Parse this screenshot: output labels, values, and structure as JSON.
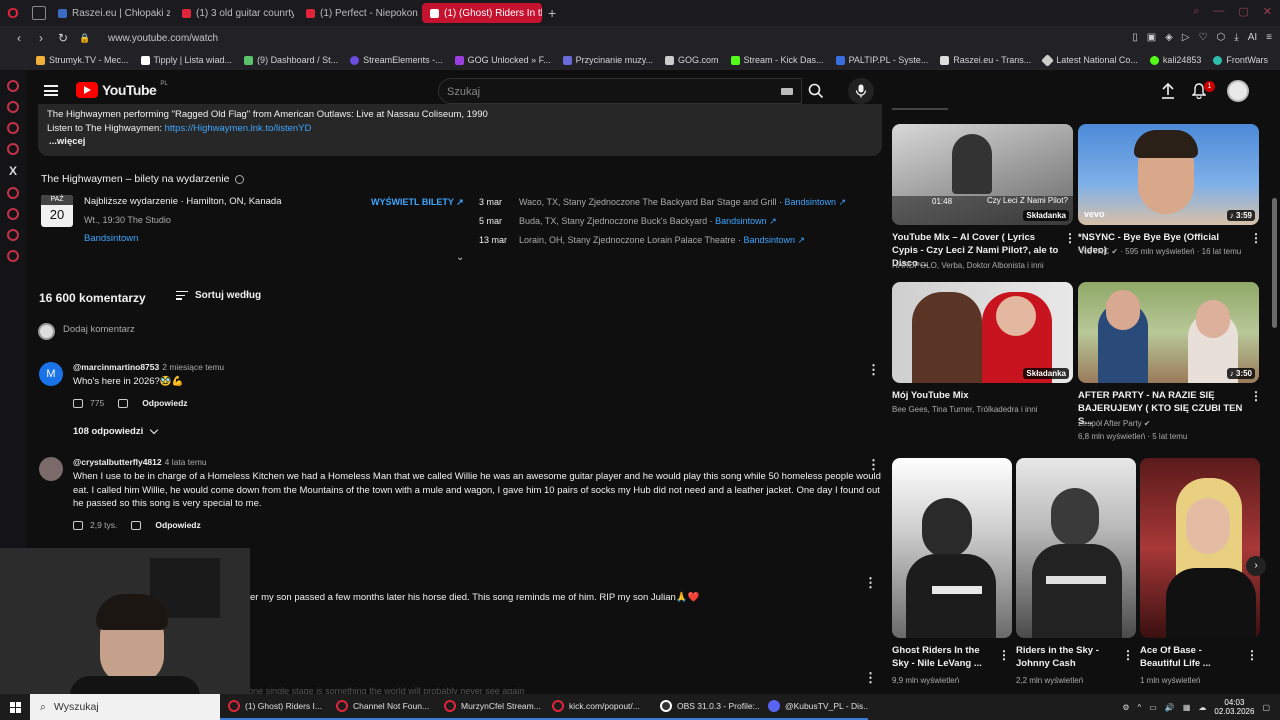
{
  "browser": {
    "tabs": [
      {
        "label": "Raszei.eu | Chłopaki z Ras",
        "fav": "#3b6cc2"
      },
      {
        "label": "(1) 3 old guitar counrty - Y",
        "fav": "#e0243a"
      },
      {
        "label": "(1) Perfect - Niepokonani",
        "fav": "#e0243a"
      },
      {
        "label": "(1) (Ghost) Riders In th",
        "fav": "#ffffff",
        "active": true
      }
    ],
    "url": "www.youtube.com/watch",
    "bookmarks": [
      {
        "label": "Strumyk.TV - Mec...",
        "color": "#f0b03a"
      },
      {
        "label": "Tipply | Lista wiad...",
        "color": "#ffffff"
      },
      {
        "label": "(9) Dashboard / St...",
        "color": "#59c26b"
      },
      {
        "label": "StreamElements -...",
        "color": "#6b4ce0"
      },
      {
        "label": "GOG Unlocked » F...",
        "color": "#9b3fe0"
      },
      {
        "label": "Przycinanie muzy...",
        "color": "#6a6ad8"
      },
      {
        "label": "GOG.com",
        "color": "#cccccc"
      },
      {
        "label": "Stream - Kick Das...",
        "color": "#53fc18"
      },
      {
        "label": "PALTIP.PL - Syste...",
        "color": "#3a6ee0"
      },
      {
        "label": "Raszei.eu - Trans...",
        "color": "#dddddd"
      },
      {
        "label": "Latest National Co...",
        "color": "#cccccc"
      },
      {
        "label": "kali24853",
        "color": "#53fc18"
      },
      {
        "label": "FrontWars",
        "color": "#2bbfae"
      }
    ],
    "address_right": "AI"
  },
  "youtube": {
    "logo_text": "YouTube",
    "logo_region": "PL",
    "search": {
      "placeholder": "Szukaj",
      "value": ""
    },
    "notifications_count": "1",
    "description": {
      "line1": "The Highwaymen performing \"Ragged Old Flag\" from American Outlaws: Live at Nassau Coliseum, 1990",
      "line2_prefix": "Listen to The Highwaymen: ",
      "line2_link": "https://Highwaymen.lnk.to/listenYD",
      "more": "...więcej"
    },
    "tickets": {
      "title": "The Highwaymen – bilety na wydarzenie",
      "date_month": "PAŹ",
      "date_day": "20",
      "event_title": "Najbliższe wydarzenie · Hamilton, ON, Kanada",
      "event_time": "Wt., 19:30 The Studio",
      "event_link": "Bandsintown",
      "button": "WYŚWIETL BILETY ↗",
      "tour": [
        {
          "date": "3 mar",
          "place": "Waco, TX, Stany Zjednoczone The Backyard Bar Stage and Grill",
          "link": "Bandsintown ↗"
        },
        {
          "date": "5 mar",
          "place": "Buda, TX, Stany Zjednoczone Buck's Backyard",
          "link": "Bandsintown ↗"
        },
        {
          "date": "13 mar",
          "place": "Lorain, OH, Stany Zjednoczone Lorain Palace Theatre",
          "link": "Bandsintown ↗"
        }
      ]
    },
    "comments": {
      "count": "16 600 komentarzy",
      "sort_label": "Sortuj według",
      "add_placeholder": "Dodaj komentarz",
      "items": [
        {
          "avatar_letter": "M",
          "avatar_color": "#1a73e8",
          "author": "@marcinmartino8753",
          "time": "2 miesiące temu",
          "text": "Who's here in 2026?🥸💪",
          "likes": "775",
          "reply": "Odpowiedz"
        },
        {
          "avatar_letter": "",
          "avatar_color": "#7a6a6a",
          "author": "@crystalbutterfly4812",
          "time": "4 lata temu",
          "text": "When I use to be in charge of a Homeless Kitchen we had a Homeless Man that we called Willie he was an awesome guitar player and he would play this song while  50 homeless people would eat.  I called him Willie, he would come down from the Mountains of the town with a mule and wagon, I gave him 10 pairs of socks my Hub did not need and a leather jacket.  One day I found out he passed so this song is very special to me.",
          "likes": "2,9 tys.",
          "reply": "Odpowiedz"
        }
      ],
      "replies_toggle": "108 odpowiedzi",
      "partial_text": "er my son passed a few months later his horse died. This song reminds me of him. RIP my son Julian🙏❤️",
      "partial_bottom": "This amount of talent and heart and soul on one single stage is something the world will probably never see again"
    },
    "recommendations": [
      {
        "title": "YouTube Mix – AI Cover ( Lyrics Cypis - Czy Leci Z Nami Pilot?, ale to Disco ...",
        "meta1": "HARDPOLO, Verba, Doktor Albonista i inni",
        "meta2": "",
        "badge": "Składanka",
        "thumb_text": "Czy Leci Z Nami Pilot?",
        "thumb_time": "01:48"
      },
      {
        "title": "*NSYNC - Bye Bye Bye (Official Video)",
        "meta1": "*NSYNC ✔ · 595 mln wyświetleń · 16 lat temu",
        "meta2": "",
        "badge": "♪ 3:59",
        "thumb_text": "vevo"
      },
      {
        "title": "Mój YouTube Mix",
        "meta1": "Bee Gees, Tina Turner, Trólkadedra i inni",
        "meta2": "",
        "badge": "Składanka"
      },
      {
        "title": "AFTER PARTY - NA RAZIE SIĘ BAJERUJEMY ( KTO SIĘ CZUBI TEN S...",
        "meta1": "Zespół After Party ✔",
        "meta2": "6,8 mln wyświetleń · 5 lat temu",
        "badge": "♪ 3:50"
      },
      {
        "title": "Ghost Riders In the Sky - Nile LeVang ...",
        "meta1": "9,9 mln wyświetleń"
      },
      {
        "title": "Riders in the Sky - Johnny Cash",
        "meta1": "2,2 mln wyświetleń"
      },
      {
        "title": "Ace Of Base - Beautiful Life ...",
        "meta1": "1 mln wyświetleń"
      }
    ]
  },
  "taskbar": {
    "search_label": "Wyszukaj",
    "apps": [
      "(1) Ghost) Riders I...",
      "Channel Not Foun...",
      "MurzynCfel Stream...",
      "kick.com/popout/...",
      "OBS 31.0.3 - Profile:...",
      "@KubusTV_PL - Dis..."
    ],
    "time": "04:03",
    "date": "02.03.2026"
  }
}
